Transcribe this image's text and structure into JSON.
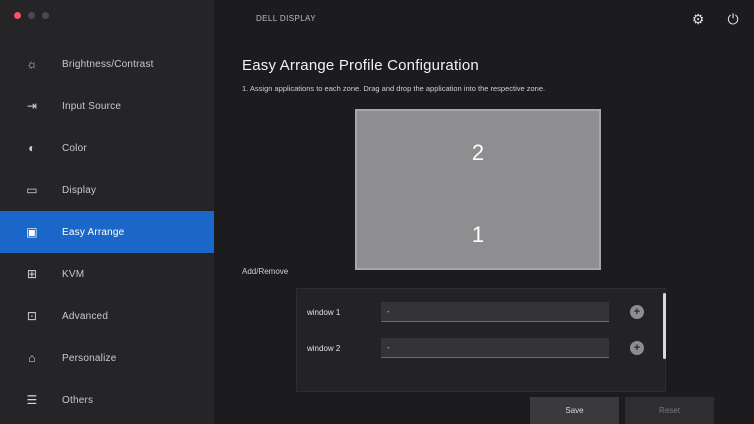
{
  "window": {
    "app_title": "DELL DISPLAY"
  },
  "sidebar": {
    "items": [
      {
        "label": "Brightness/Contrast",
        "icon": "brightness-icon",
        "glyph": "☼",
        "active": false
      },
      {
        "label": "Input Source",
        "icon": "input-source-icon",
        "glyph": "⇥",
        "active": false
      },
      {
        "label": "Color",
        "icon": "color-icon",
        "glyph": "◐",
        "active": false
      },
      {
        "label": "Display",
        "icon": "display-icon",
        "glyph": "▭",
        "active": false
      },
      {
        "label": "Easy Arrange",
        "icon": "easy-arrange-icon",
        "glyph": "▣",
        "active": true
      },
      {
        "label": "KVM",
        "icon": "kvm-icon",
        "glyph": "⊞",
        "active": false
      },
      {
        "label": "Advanced",
        "icon": "advanced-icon",
        "glyph": "⊡",
        "active": false
      },
      {
        "label": "Personalize",
        "icon": "personalize-icon",
        "glyph": "⌂",
        "active": false
      },
      {
        "label": "Others",
        "icon": "others-icon",
        "glyph": "☰",
        "active": false
      }
    ]
  },
  "header": {
    "settings_icon": "⚙",
    "power_icon": "⏻"
  },
  "main": {
    "title": "Easy Arrange Profile Configuration",
    "description": "1. Assign applications to each zone. Drag and drop the application into the respective zone.",
    "zones": [
      {
        "number": "2"
      },
      {
        "number": "1"
      }
    ],
    "section_label": "Add/Remove",
    "app_rows": [
      {
        "label": "window 1",
        "value": "-"
      },
      {
        "label": "window 2",
        "value": "-"
      }
    ],
    "save_label": "Save",
    "reset_label": "Reset"
  },
  "colors": {
    "accent": "#1b66c9",
    "sidebar_bg": "#252527",
    "main_bg": "#1c1c1e",
    "close_dot": "#f0566a"
  }
}
